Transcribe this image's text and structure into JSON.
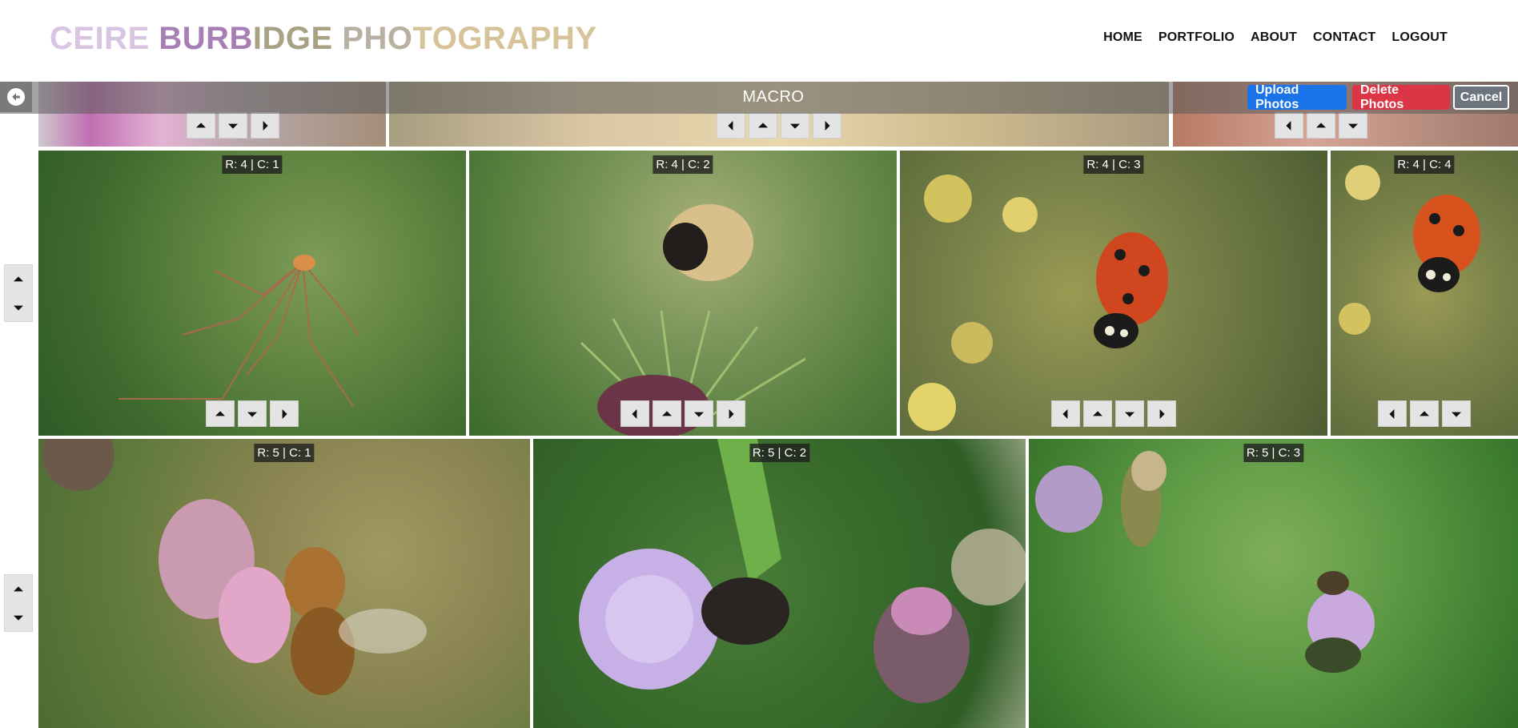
{
  "brand": {
    "title_parts": [
      {
        "text": "CEIRE ",
        "color": "#d9c4e2"
      },
      {
        "text": "BURB",
        "color": "#a87fb4"
      },
      {
        "text": "IDGE ",
        "color": "#a9a184"
      },
      {
        "text": "PHO",
        "color": "#b8b0a0"
      },
      {
        "text": "TOGRAPHY",
        "color": "#d7c39a"
      }
    ]
  },
  "nav": {
    "items": [
      "HOME",
      "PORTFOLIO",
      "ABOUT",
      "CONTACT",
      "LOGOUT"
    ]
  },
  "section": {
    "title": "MACRO"
  },
  "actions": {
    "upload_label": "Upload Photos",
    "delete_label": "Delete Photos",
    "cancel_label": "Cancel"
  },
  "icons": {
    "back": "arrow-left-circle-icon",
    "left": "caret-left-icon",
    "right": "caret-right-icon",
    "up": "caret-up-icon",
    "down": "caret-down-icon"
  },
  "row4": {
    "photos": [
      {
        "label": "R: 4 | C: 1",
        "subject": "spider"
      },
      {
        "label": "R: 4 | C: 2",
        "subject": "bumblebee"
      },
      {
        "label": "R: 4 | C: 3",
        "subject": "ladybird"
      },
      {
        "label": "R: 4 | C: 4",
        "subject": "ladybird"
      }
    ]
  },
  "row5": {
    "photos": [
      {
        "label": "R: 5 | C: 1",
        "subject": "honeybee"
      },
      {
        "label": "R: 5 | C: 2",
        "subject": "bee on thistle"
      },
      {
        "label": "R: 5 | C: 3",
        "subject": "bee on thistle"
      }
    ]
  },
  "colors": {
    "upload": "#1a73e8",
    "delete": "#dc3545",
    "cancel": "#6c757d"
  }
}
